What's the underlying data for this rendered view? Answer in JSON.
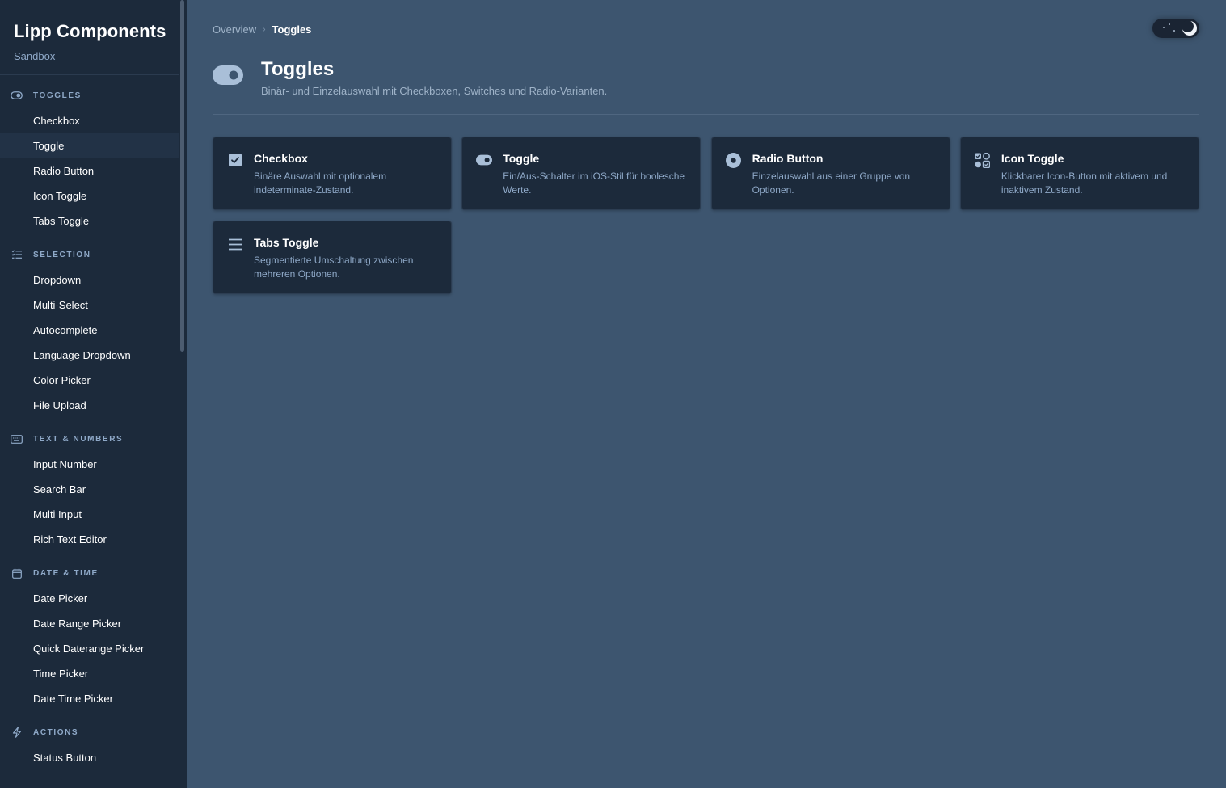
{
  "brand": {
    "title": "Lipp Components",
    "subtitle": "Sandbox"
  },
  "sidebar": {
    "sections": [
      {
        "label": "TOGGLES",
        "icon": "toggle-icon",
        "items": [
          "Checkbox",
          "Toggle",
          "Radio Button",
          "Icon Toggle",
          "Tabs Toggle"
        ]
      },
      {
        "label": "SELECTION",
        "icon": "list-check-icon",
        "items": [
          "Dropdown",
          "Multi-Select",
          "Autocomplete",
          "Language Dropdown",
          "Color Picker",
          "File Upload"
        ]
      },
      {
        "label": "TEXT & NUMBERS",
        "icon": "keyboard-icon",
        "items": [
          "Input Number",
          "Search Bar",
          "Multi Input",
          "Rich Text Editor"
        ]
      },
      {
        "label": "DATE & TIME",
        "icon": "calendar-icon",
        "items": [
          "Date Picker",
          "Date Range Picker",
          "Quick Daterange Picker",
          "Time Picker",
          "Date Time Picker"
        ]
      },
      {
        "label": "ACTIONS",
        "icon": "bolt-icon",
        "items": [
          "Status Button"
        ]
      }
    ],
    "active_item": "Toggle"
  },
  "breadcrumb": {
    "parent": "Overview",
    "separator": "›",
    "current": "Toggles"
  },
  "header": {
    "title": "Toggles",
    "subtitle": "Binär- und Einzelauswahl mit Checkboxen, Switches und Radio-Varianten."
  },
  "cards": [
    {
      "icon": "checkbox-icon",
      "title": "Checkbox",
      "desc": "Binäre Auswahl mit optionalem indeterminate-Zustand."
    },
    {
      "icon": "toggle-icon",
      "title": "Toggle",
      "desc": "Ein/Aus-Schalter im iOS-Stil für boolesche Werte."
    },
    {
      "icon": "radio-icon",
      "title": "Radio Button",
      "desc": "Einzelauswahl aus einer Gruppe von Optionen."
    },
    {
      "icon": "icon-toggle-icon",
      "title": "Icon Toggle",
      "desc": "Klickbarer Icon-Button mit aktivem und inaktivem Zustand."
    },
    {
      "icon": "menu-icon",
      "title": "Tabs Toggle",
      "desc": "Segmentierte Umschaltung zwischen mehreren Optionen."
    }
  ],
  "colors": {
    "sidebar_bg": "#1c2a3b",
    "main_bg": "#3d556f",
    "card_bg": "#1c2a3b",
    "accent": "#8fa9c8"
  },
  "theme_toggle": {
    "state": "dark"
  }
}
